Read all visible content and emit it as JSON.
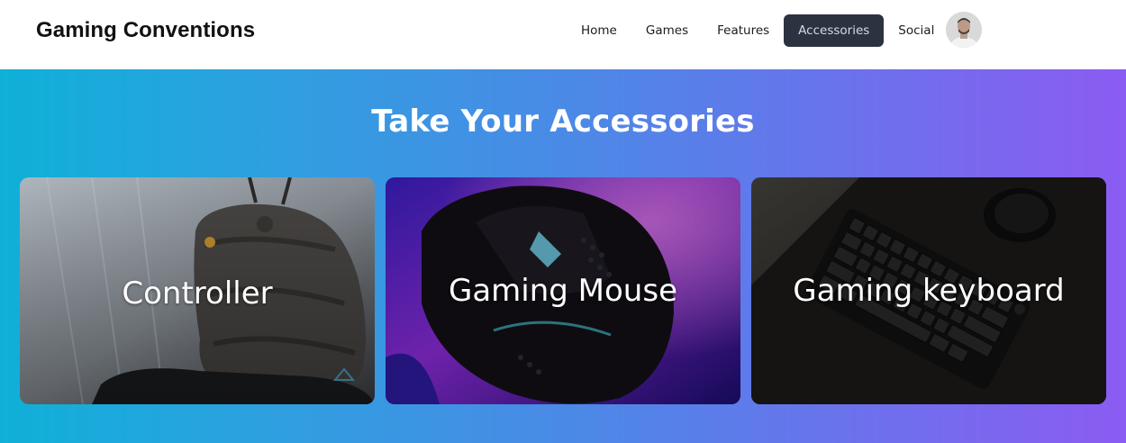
{
  "header": {
    "brand": "Gaming Conventions",
    "nav": [
      {
        "label": "Home",
        "active": false
      },
      {
        "label": "Games",
        "active": false
      },
      {
        "label": "Features",
        "active": false
      },
      {
        "label": "Accessories",
        "active": true
      },
      {
        "label": "Social",
        "active": false
      }
    ]
  },
  "hero": {
    "title": "Take Your Accessories",
    "cards": [
      {
        "label": "Controller"
      },
      {
        "label": "Gaming Mouse"
      },
      {
        "label": "Gaming keyboard"
      }
    ]
  },
  "colors": {
    "active_nav_bg": "#2b3240",
    "gradient_start": "#0fb0d8",
    "gradient_end": "#8b5cf2"
  }
}
